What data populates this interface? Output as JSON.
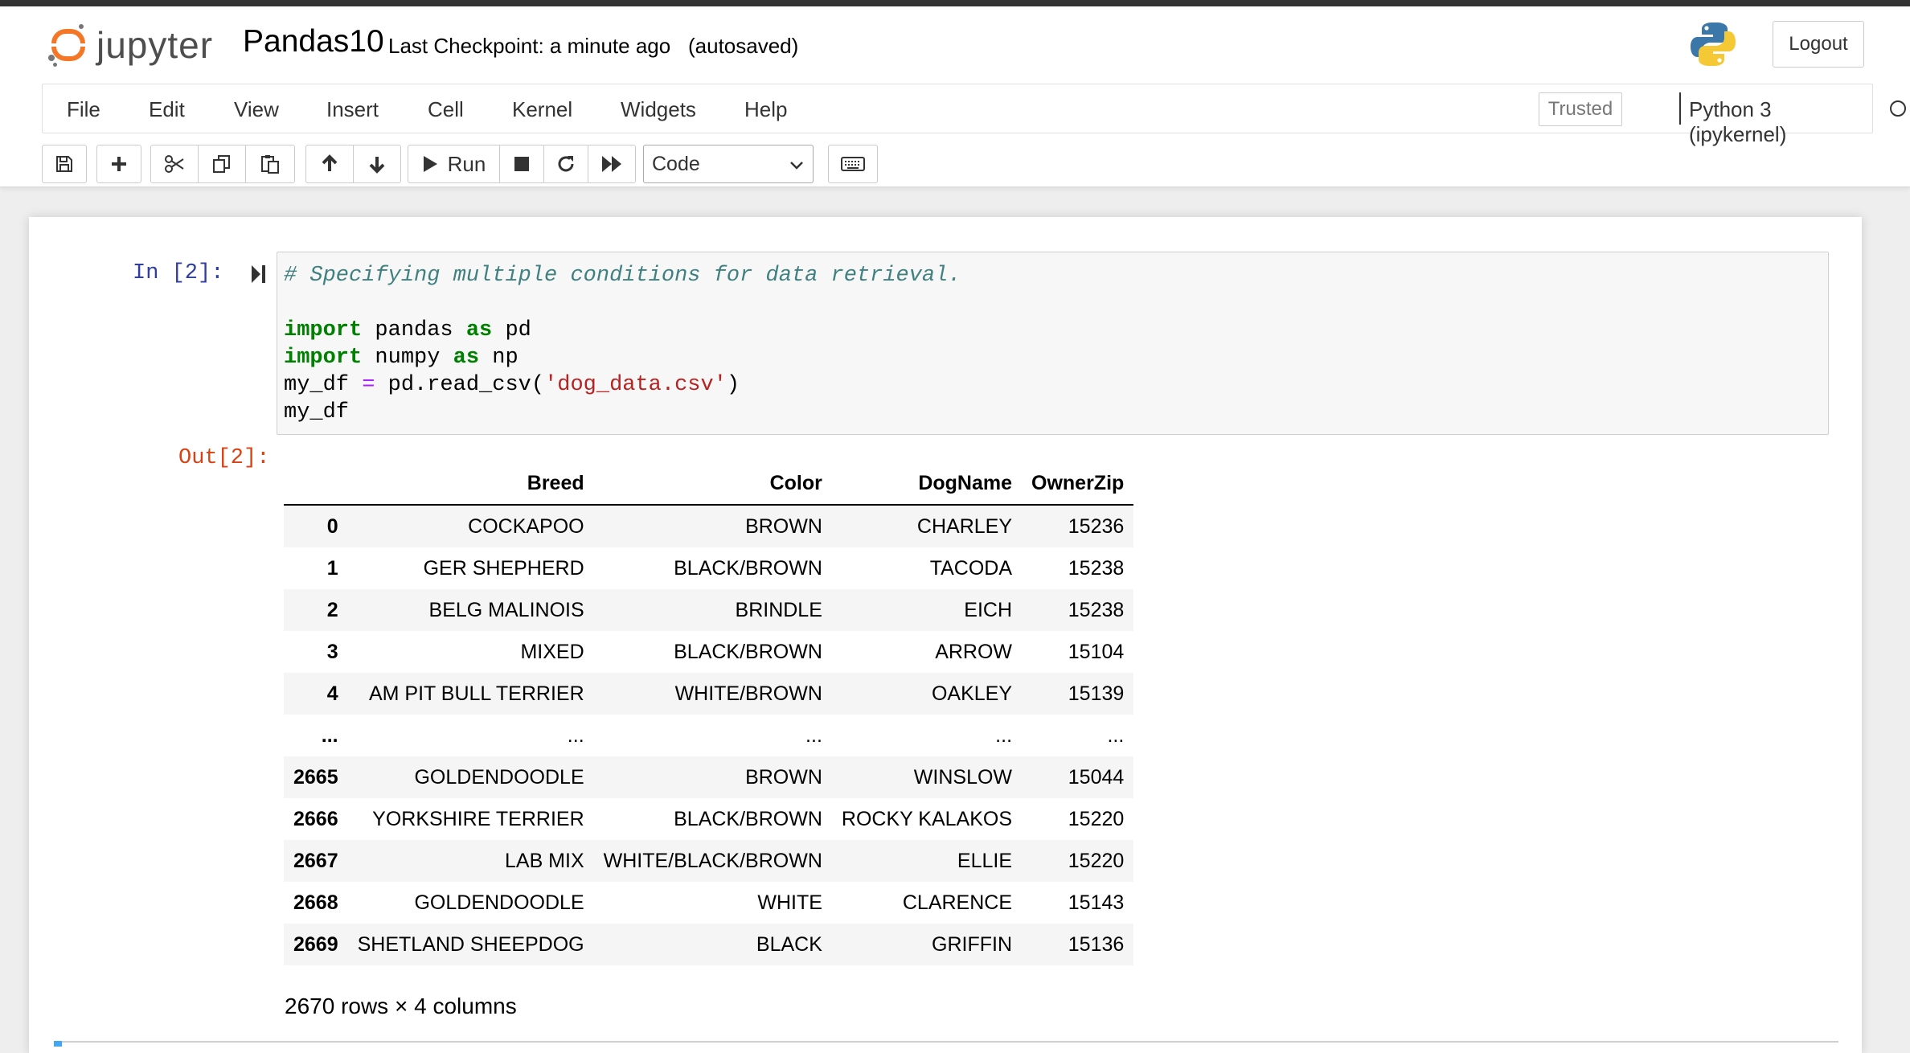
{
  "header": {
    "logo_text": "jupyter",
    "notebook_name": "Pandas10",
    "checkpoint_text": "Last Checkpoint: a minute ago",
    "autosave_status": "(autosaved)",
    "logout_label": "Logout",
    "brand_color": "#f37726",
    "python_logo_icon": "python-logo-icon"
  },
  "menubar": {
    "items": [
      "File",
      "Edit",
      "View",
      "Insert",
      "Cell",
      "Kernel",
      "Widgets",
      "Help"
    ],
    "trusted_label": "Trusted",
    "kernel_name": "Python 3 (ipykernel)",
    "kernel_status_icon": "kernel-idle-circle-icon"
  },
  "toolbar": {
    "buttons": [
      "save-icon",
      "plus-icon",
      "cut-icon",
      "copy-icon",
      "paste-icon",
      "arrow-up-icon",
      "arrow-down-icon",
      "run",
      "stop-icon",
      "restart-icon",
      "fast-forward-icon",
      "keyboard-icon"
    ],
    "run_label": "Run",
    "cell_type": "Code"
  },
  "cell": {
    "in_prompt": "In [2]:",
    "out_prompt": "Out[2]:",
    "code": {
      "comment": "# Specifying multiple conditions for data retrieval.",
      "line2_kw1": "import",
      "line2_mod": " pandas ",
      "line2_kw2": "as",
      "line2_alias": " pd",
      "line3_kw1": "import",
      "line3_mod": " numpy ",
      "line3_kw2": "as",
      "line3_alias": " np",
      "line4_var": "my_df ",
      "line4_op": "=",
      "line4_call": " pd.read_csv(",
      "line4_str": "'dog_data.csv'",
      "line4_end": ")",
      "line5": "my_df"
    }
  },
  "dataframe": {
    "columns": [
      "",
      "Breed",
      "Color",
      "DogName",
      "OwnerZip"
    ],
    "rows": [
      [
        "0",
        "COCKAPOO",
        "BROWN",
        "CHARLEY",
        "15236"
      ],
      [
        "1",
        "GER SHEPHERD",
        "BLACK/BROWN",
        "TACODA",
        "15238"
      ],
      [
        "2",
        "BELG MALINOIS",
        "BRINDLE",
        "EICH",
        "15238"
      ],
      [
        "3",
        "MIXED",
        "BLACK/BROWN",
        "ARROW",
        "15104"
      ],
      [
        "4",
        "AM PIT BULL TERRIER",
        "WHITE/BROWN",
        "OAKLEY",
        "15139"
      ],
      [
        "...",
        "...",
        "...",
        "...",
        "..."
      ],
      [
        "2665",
        "GOLDENDOODLE",
        "BROWN",
        "WINSLOW",
        "15044"
      ],
      [
        "2666",
        "YORKSHIRE TERRIER",
        "BLACK/BROWN",
        "ROCKY KALAKOS",
        "15220"
      ],
      [
        "2667",
        "LAB MIX",
        "WHITE/BLACK/BROWN",
        "ELLIE",
        "15220"
      ],
      [
        "2668",
        "GOLDENDOODLE",
        "WHITE",
        "CLARENCE",
        "15143"
      ],
      [
        "2669",
        "SHETLAND SHEEPDOG",
        "BLACK",
        "GRIFFIN",
        "15136"
      ]
    ],
    "shape_text": "2670 rows × 4 columns"
  }
}
